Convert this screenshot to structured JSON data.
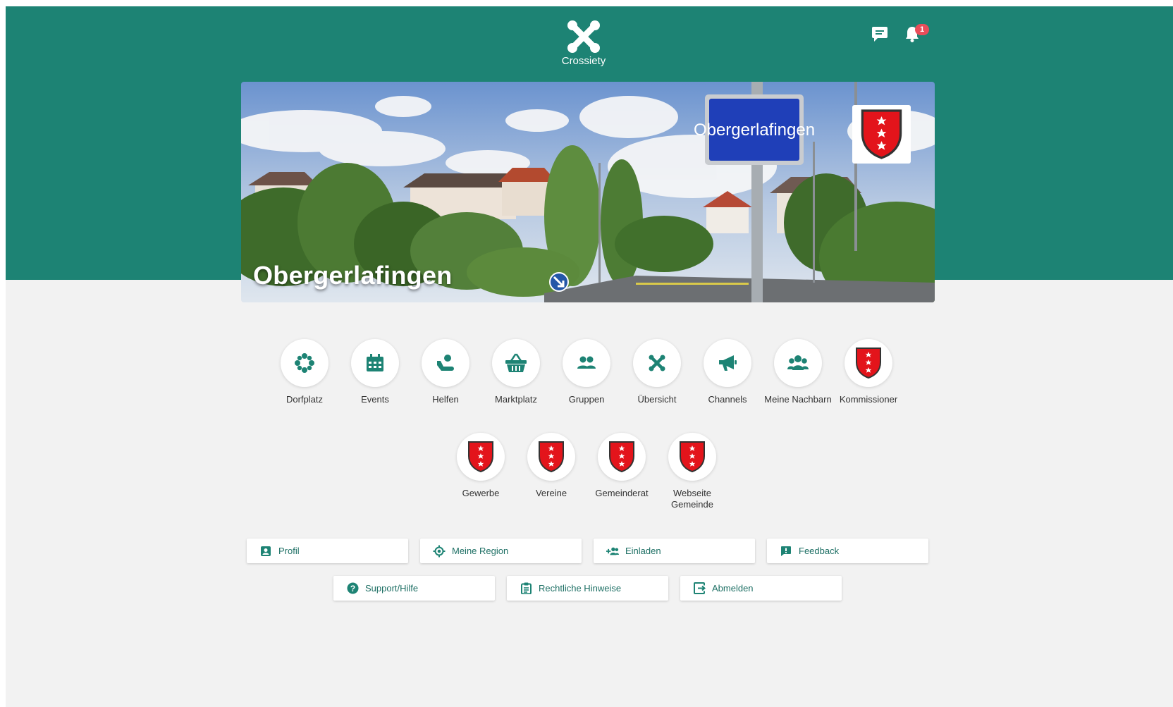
{
  "header": {
    "brand": "Crossiety",
    "notification_count": "1",
    "icons": [
      "chat-icon",
      "bell-icon"
    ]
  },
  "hero": {
    "title": "Obergerlafingen",
    "sign_text": "Obergerlafingen"
  },
  "apps_row1": [
    {
      "label": "Dorfplatz",
      "icon": "dorfplatz-icon"
    },
    {
      "label": "Events",
      "icon": "calendar-icon"
    },
    {
      "label": "Helfen",
      "icon": "helping-hand-icon"
    },
    {
      "label": "Marktplatz",
      "icon": "basket-icon"
    },
    {
      "label": "Gruppen",
      "icon": "people-icon"
    },
    {
      "label": "Übersicht",
      "icon": "crossiety-icon"
    },
    {
      "label": "Channels",
      "icon": "megaphone-icon"
    },
    {
      "label": "Meine Nachbarn",
      "icon": "group-icon"
    },
    {
      "label": "Kommissioner",
      "icon": "crest-icon"
    }
  ],
  "apps_row2": [
    {
      "label": "Gewerbe",
      "icon": "crest-icon"
    },
    {
      "label": "Vereine",
      "icon": "crest-icon"
    },
    {
      "label": "Gemeinderat",
      "icon": "crest-icon"
    },
    {
      "label": "Webseite Gemeinde",
      "icon": "crest-icon"
    }
  ],
  "buttons_row1": [
    {
      "label": "Profil",
      "icon": "profile-icon"
    },
    {
      "label": "Meine Region",
      "icon": "location-icon"
    },
    {
      "label": "Einladen",
      "icon": "invite-icon"
    },
    {
      "label": "Feedback",
      "icon": "feedback-icon"
    }
  ],
  "buttons_row2": [
    {
      "label": "Support/Hilfe",
      "icon": "help-icon"
    },
    {
      "label": "Rechtliche Hinweise",
      "icon": "clipboard-icon"
    },
    {
      "label": "Abmelden",
      "icon": "logout-icon"
    }
  ],
  "colors": {
    "brand_teal": "#1d8374",
    "background": "#f2f2f2",
    "crest_red": "#e3141b",
    "badge_red": "#e94d5a"
  }
}
